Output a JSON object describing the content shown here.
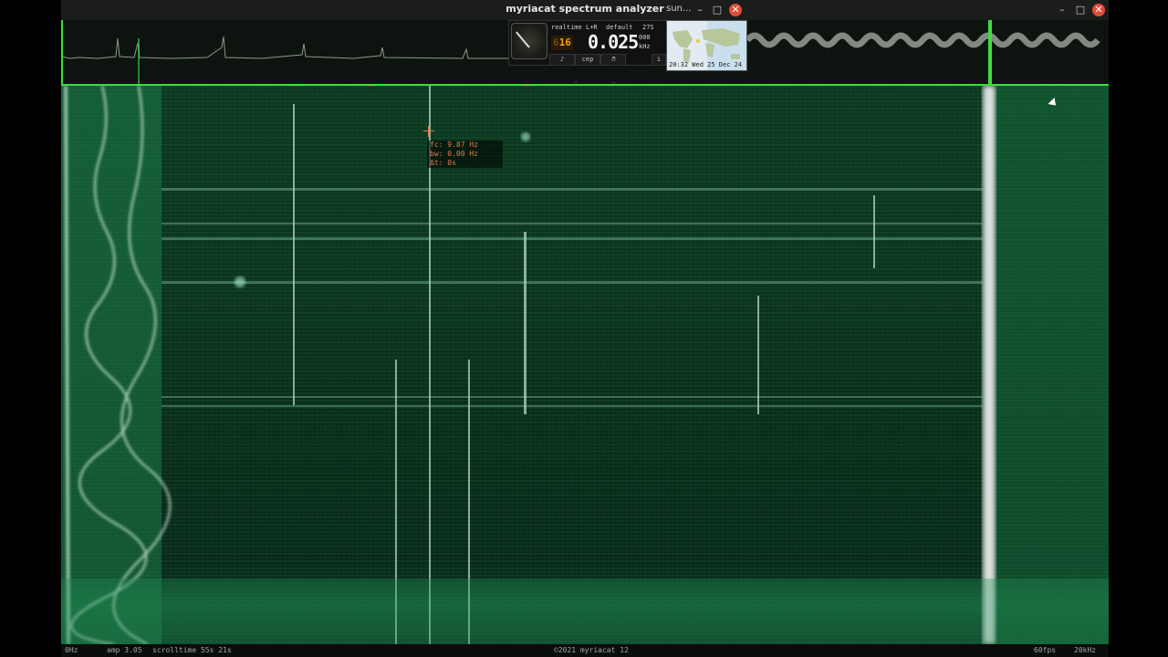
{
  "window": {
    "title": "myriacat spectrum analyzer",
    "secondary_tab": "sun..."
  },
  "controls": {
    "mode": "realtime",
    "channels": "L+R",
    "preset": "default",
    "counter": "27S",
    "lcd_value": "16",
    "lcd_prefix": "6",
    "main_value": "0.025",
    "small_value": "000",
    "unit": "kHz",
    "btn_a": "♪",
    "btn_cep": "cep",
    "btn_b": "♬",
    "btn_info": "i"
  },
  "map": {
    "timestamp": "20:32 Wed 25 Dec 24"
  },
  "watermark": "myriacat",
  "readout": {
    "fc": "fc: 9.87 Hz",
    "bw": "bw: 0.00 Hz",
    "dt": "Δt: 0s"
  },
  "status": {
    "left": "0Hz",
    "amp": "amp 3.05",
    "scrolltime": "scrolltime 55s 21s",
    "copyright": "©2021 myriacat 12",
    "fps": "60fps",
    "right": "20kHz"
  },
  "colors": {
    "accent": "#3edc3e",
    "spectrogram": "#0b3320",
    "close": "#e24a3a",
    "marker": "#c9b238"
  }
}
